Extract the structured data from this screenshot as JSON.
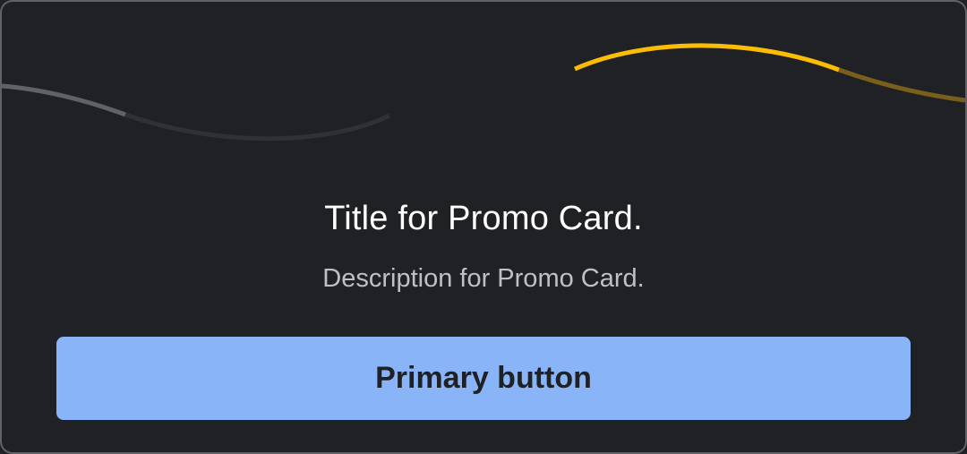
{
  "promo_card": {
    "title": "Title for Promo Card.",
    "description": "Description for Promo Card.",
    "primary_button_label": "Primary button"
  },
  "colors": {
    "background": "#202124",
    "border": "#5f6368",
    "title": "#ffffff",
    "description": "#bdc1c6",
    "button_background": "#8ab4f8",
    "button_text": "#202124",
    "accent_yellow": "#fbbc04"
  }
}
